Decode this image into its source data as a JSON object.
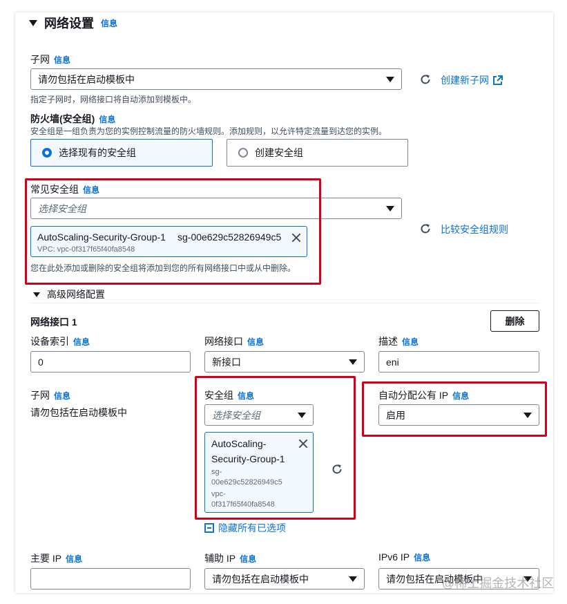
{
  "network": {
    "title": "网络设置",
    "info": "信息",
    "subnet": {
      "label": "子网",
      "info": "信息",
      "value": "请勿包括在启动模板中",
      "hint": "指定子网时，网络接口将自动添加到模板中。",
      "create_link": "创建新子网"
    },
    "firewall": {
      "label": "防火墙(安全组)",
      "info": "信息",
      "description": "安全组是一组负责为您的实例控制流量的防火墙规则。添加规则，以允许特定流量到达您的实例。",
      "option_existing": "选择现有的安全组",
      "option_create": "创建安全组"
    },
    "common_sg": {
      "label": "常见安全组",
      "info": "信息",
      "placeholder": "选择安全组",
      "token_name": "AutoScaling-Security-Group-1",
      "token_id": "sg-00e629c52826949c5",
      "token_vpc": "VPC: vpc-0f317f65f40fa8548",
      "hint": "您在此处添加或删除的安全组将添加到您的所有网络接口中或从中删除。",
      "compare_link": "比较安全组规则"
    },
    "advanced": {
      "title": "高级网络配置",
      "interface_title": "网络接口 1",
      "delete_button": "删除",
      "device_index": {
        "label": "设备索引",
        "info": "信息",
        "value": "0"
      },
      "network_interface": {
        "label": "网络接口",
        "info": "信息",
        "value": "新接口"
      },
      "description": {
        "label": "描述",
        "info": "信息",
        "value": "eni"
      },
      "subnet": {
        "label": "子网",
        "info": "信息",
        "value": "请勿包括在启动模板中"
      },
      "security_group": {
        "label": "安全组",
        "info": "信息",
        "placeholder": "选择安全组",
        "token_name_1": "AutoScaling-",
        "token_name_2": "Security-Group-1",
        "token_id_1": "sg-",
        "token_id_2": "00e629c52826949c5",
        "token_vpc_1": "vpc-",
        "token_vpc_2": "0f317f65f40fa8548",
        "hide_link": "隐藏所有已选项"
      },
      "public_ip": {
        "label": "自动分配公有 IP",
        "info": "信息",
        "value": "启用"
      },
      "primary_ip": {
        "label": "主要 IP",
        "info": "信息",
        "value": ""
      },
      "secondary_ip": {
        "label": "辅助 IP",
        "info": "信息",
        "value": "请勿包括在启动模板中"
      },
      "ipv6_ip": {
        "label": "IPv6 IP",
        "info": "信息",
        "value": "请勿包括在启动模板中"
      }
    }
  },
  "watermark": "@稀土掘金技术社区",
  "colors": {
    "link": "#0972d3",
    "highlight": "#d0021b",
    "selected_bg": "#f2f8fd"
  }
}
